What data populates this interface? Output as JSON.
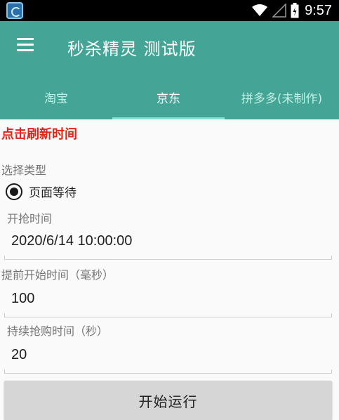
{
  "status_bar": {
    "time": "9:57"
  },
  "app_bar": {
    "title": "秒杀精灵 测试版"
  },
  "tabs": [
    {
      "label": "淘宝"
    },
    {
      "label": "京东"
    },
    {
      "label": "拼多多(未制作)"
    }
  ],
  "active_tab": "京东",
  "refresh_text": "点击刷新时间",
  "type_section": {
    "label": "选择类型",
    "selected_option": "页面等待"
  },
  "fields": {
    "start_time": {
      "label": "开抢时间",
      "value": "2020/6/14 10:00:00"
    },
    "advance_ms": {
      "label": "提前开始时间（毫秒）",
      "value": "100"
    },
    "duration_s": {
      "label": "持续抢购时间（秒）",
      "value": "20"
    }
  },
  "start_button": {
    "label": "开始运行"
  },
  "colors": {
    "primary": "#44a596",
    "accent": "#e0251b",
    "button": "#d6d6d6"
  }
}
